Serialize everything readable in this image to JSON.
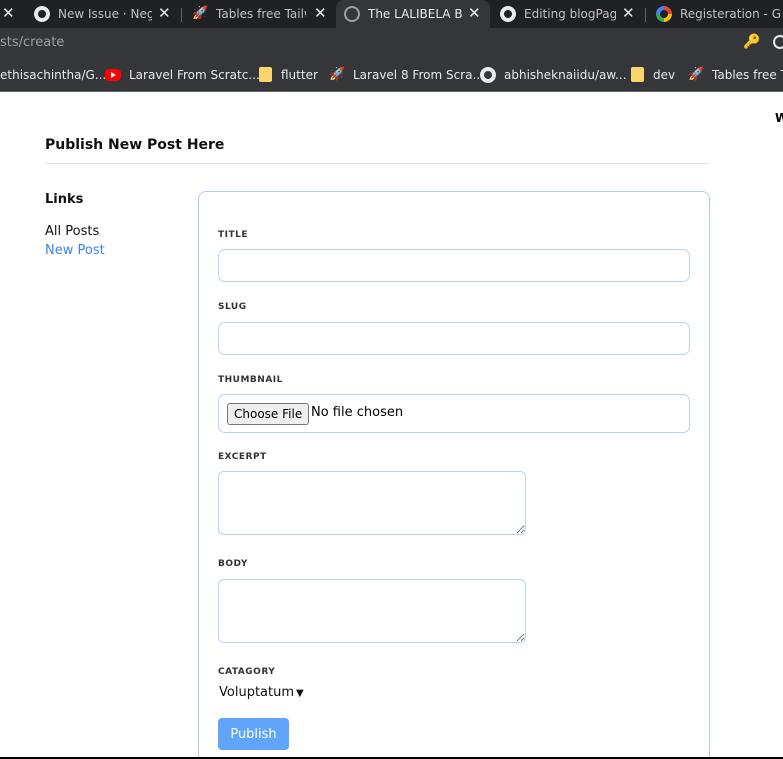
{
  "browser": {
    "tabs": [
      {
        "title": "New Issue · Negu",
        "icon": "github-icon",
        "active": false
      },
      {
        "title": "Tables free Tailwi",
        "icon": "rocket-icon",
        "active": false
      },
      {
        "title": "The LALIBELA Blo",
        "icon": "globe-icon",
        "active": true
      },
      {
        "title": "Editing blogPage",
        "icon": "github-icon",
        "active": false
      },
      {
        "title": "Registeration - G",
        "icon": "google-icon",
        "active": false
      }
    ],
    "close_glyph": "✕",
    "url": "sts/create",
    "bookmarks": [
      {
        "label": "ethisachintha/G...",
        "icon": "none"
      },
      {
        "label": "Laravel From Scratc...",
        "icon": "youtube-icon"
      },
      {
        "label": "flutter",
        "icon": "folder-icon"
      },
      {
        "label": "Laravel 8 From Scra...",
        "icon": "rocket-icon"
      },
      {
        "label": "abhisheknaiidu/aw...",
        "icon": "github-icon"
      },
      {
        "label": "dev",
        "icon": "folder-icon"
      },
      {
        "label": "Tables free Tail",
        "icon": "rocket-icon"
      }
    ]
  },
  "page": {
    "corner_text": "W",
    "title": "Publish New Post Here",
    "links": {
      "heading": "Links",
      "all_posts": "All Posts",
      "new_post": "New Post"
    },
    "form": {
      "title_label": "TITLE",
      "title_value": "",
      "slug_label": "SLUG",
      "slug_value": "",
      "thumbnail_label": "THUMBNAIL",
      "choose_file": "Choose File",
      "file_status": "No file chosen",
      "excerpt_label": "EXCERPT",
      "body_label": "BODY",
      "category_label": "CATAGORY",
      "category_value": "Voluptatum",
      "publish": "Publish"
    }
  },
  "colors": {
    "accent": "#3b82f6",
    "publish_button": "#60a5fa",
    "card_border": "#a9cdf5"
  }
}
